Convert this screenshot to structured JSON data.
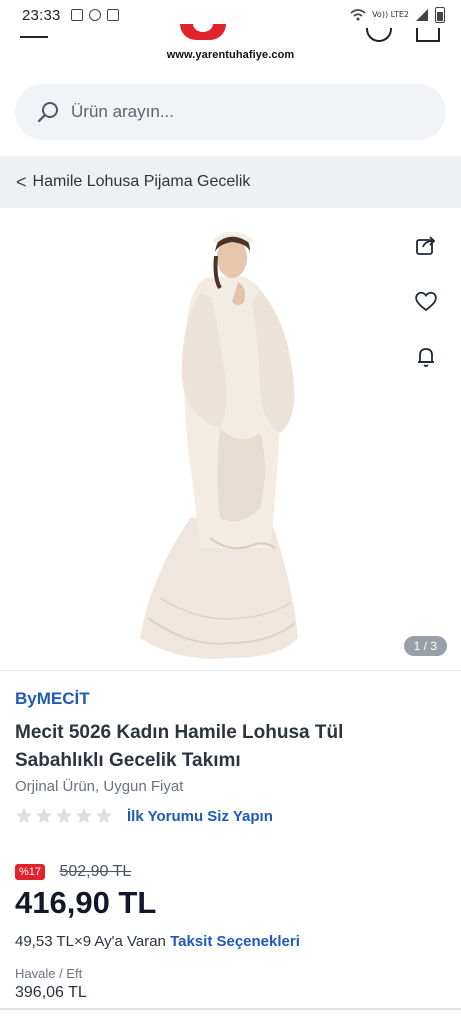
{
  "status_bar": {
    "time": "23:33",
    "network_label": "Vo)) LTE2"
  },
  "header": {
    "logo_text": "www.yarentuhafiye.com"
  },
  "search": {
    "placeholder": "Ürün arayın..."
  },
  "breadcrumb": {
    "chevron": "<",
    "label": "Hamile Lohusa Pijama Gecelik"
  },
  "gallery": {
    "pager": "1 / 3"
  },
  "product": {
    "brand": "ByMECİT",
    "title": "Mecit 5026 Kadın Hamile Lohusa Tül Sabahlıklı Gecelik Takımı",
    "subtitle": "Orjinal Ürün, Uygun Fiyat",
    "rating": 0,
    "review_link": "İlk Yorumu Siz Yapın",
    "discount_badge": "%17",
    "old_price": "502,90 TL",
    "price": "416,90 TL",
    "installment_text": "49,53 TL×9 Ay'a Varan",
    "installment_link": "Taksit Seçenekleri",
    "transfer_label": "Havale / Eft",
    "transfer_price": "396,06 TL"
  },
  "colors": {
    "accent_blue": "#1e5ab8",
    "brand_red": "#e0232d"
  },
  "icons": [
    "search-icon",
    "share-icon",
    "heart-icon",
    "bell-icon",
    "star-icon",
    "chevron-left-icon",
    "menu-icon",
    "user-icon",
    "bag-icon"
  ]
}
